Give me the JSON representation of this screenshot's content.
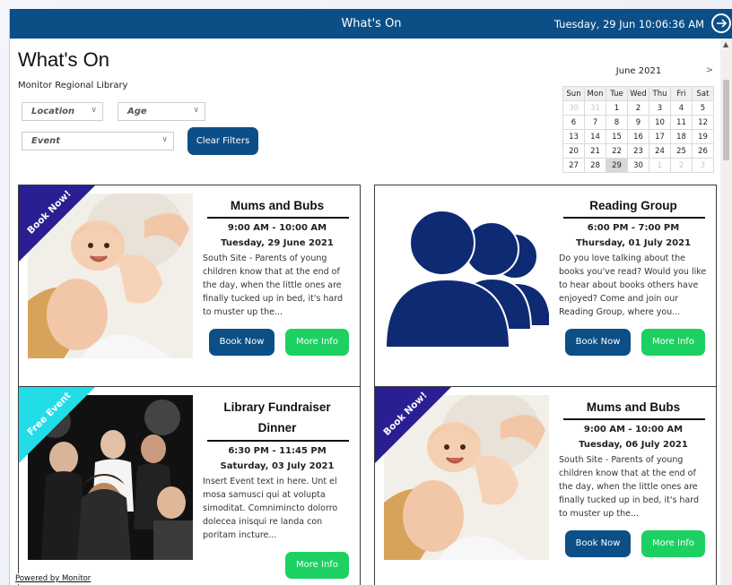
{
  "titlebar": {
    "title": "What's On",
    "datetime": "Tuesday, 29 Jun 10:06:36 AM"
  },
  "page": {
    "title": "What's On",
    "subtitle": "Monitor Regional Library"
  },
  "filters": {
    "location": "Location",
    "age": "Age",
    "event": "Event",
    "clear_label": "Clear Filters"
  },
  "calendar": {
    "month_label": "June 2021",
    "next_label": ">",
    "weekdays": [
      "Sun",
      "Mon",
      "Tue",
      "Wed",
      "Thu",
      "Fri",
      "Sat"
    ],
    "weeks": [
      [
        "30",
        "31",
        "1",
        "2",
        "3",
        "4",
        "5"
      ],
      [
        "6",
        "7",
        "8",
        "9",
        "10",
        "11",
        "12"
      ],
      [
        "13",
        "14",
        "15",
        "16",
        "17",
        "18",
        "19"
      ],
      [
        "20",
        "21",
        "22",
        "23",
        "24",
        "25",
        "26"
      ],
      [
        "27",
        "28",
        "29",
        "30",
        "1",
        "2",
        "3"
      ]
    ],
    "today": "29"
  },
  "events": [
    {
      "ribbon": "Book Now!",
      "ribbon_color": "#2a1f92",
      "title": "Mums and Bubs",
      "time": "9:00 AM - 10:00 AM",
      "date": "Tuesday, 29 June 2021",
      "description": "South Site - Parents of young children know that at the end of the day, when the little ones are finally tucked up in bed, it's hard to muster up the...",
      "book_label": "Book Now",
      "more_label": "More Info",
      "image": "mother-baby-photo"
    },
    {
      "ribbon": "",
      "title": "Reading Group",
      "time": "6:00 PM - 7:00 PM",
      "date": "Thursday, 01 July 2021",
      "description": "Do you love talking about the books you've read? Would you like to hear about books others have enjoyed? Come and join our Reading Group, where you...",
      "book_label": "Book Now",
      "more_label": "More Info",
      "image": "group-people-icon"
    },
    {
      "ribbon": "Free Event",
      "ribbon_color": "#22dde8",
      "title": "Library Fundraiser Dinner",
      "time": "6:30 PM - 11:45 PM",
      "date": "Saturday, 03 July 2021",
      "description": "Insert Event text in here. Unt el mosa samusci qui at volupta simoditat. Comnimincto dolorro dolecea inisqui re landa con poritam incture...",
      "book_label": "",
      "more_label": "More Info",
      "image": "party-photo"
    },
    {
      "ribbon": "Book Now!",
      "ribbon_color": "#2a1f92",
      "title": "Mums and Bubs",
      "time": "9:00 AM - 10:00 AM",
      "date": "Tuesday, 06 July 2021",
      "description": "South Site - Parents of young children know that at the end of the day, when the little ones are finally tucked up in bed, it's hard to muster up the...",
      "book_label": "Book Now",
      "more_label": "More Info",
      "image": "mother-baby-photo"
    }
  ],
  "footer": {
    "powered_by": "Powered by Monitor"
  },
  "colors": {
    "primary": "#0c4f86",
    "more_info": "#1cd161",
    "ribbon_book": "#2a1f92",
    "ribbon_free": "#22dde8"
  }
}
